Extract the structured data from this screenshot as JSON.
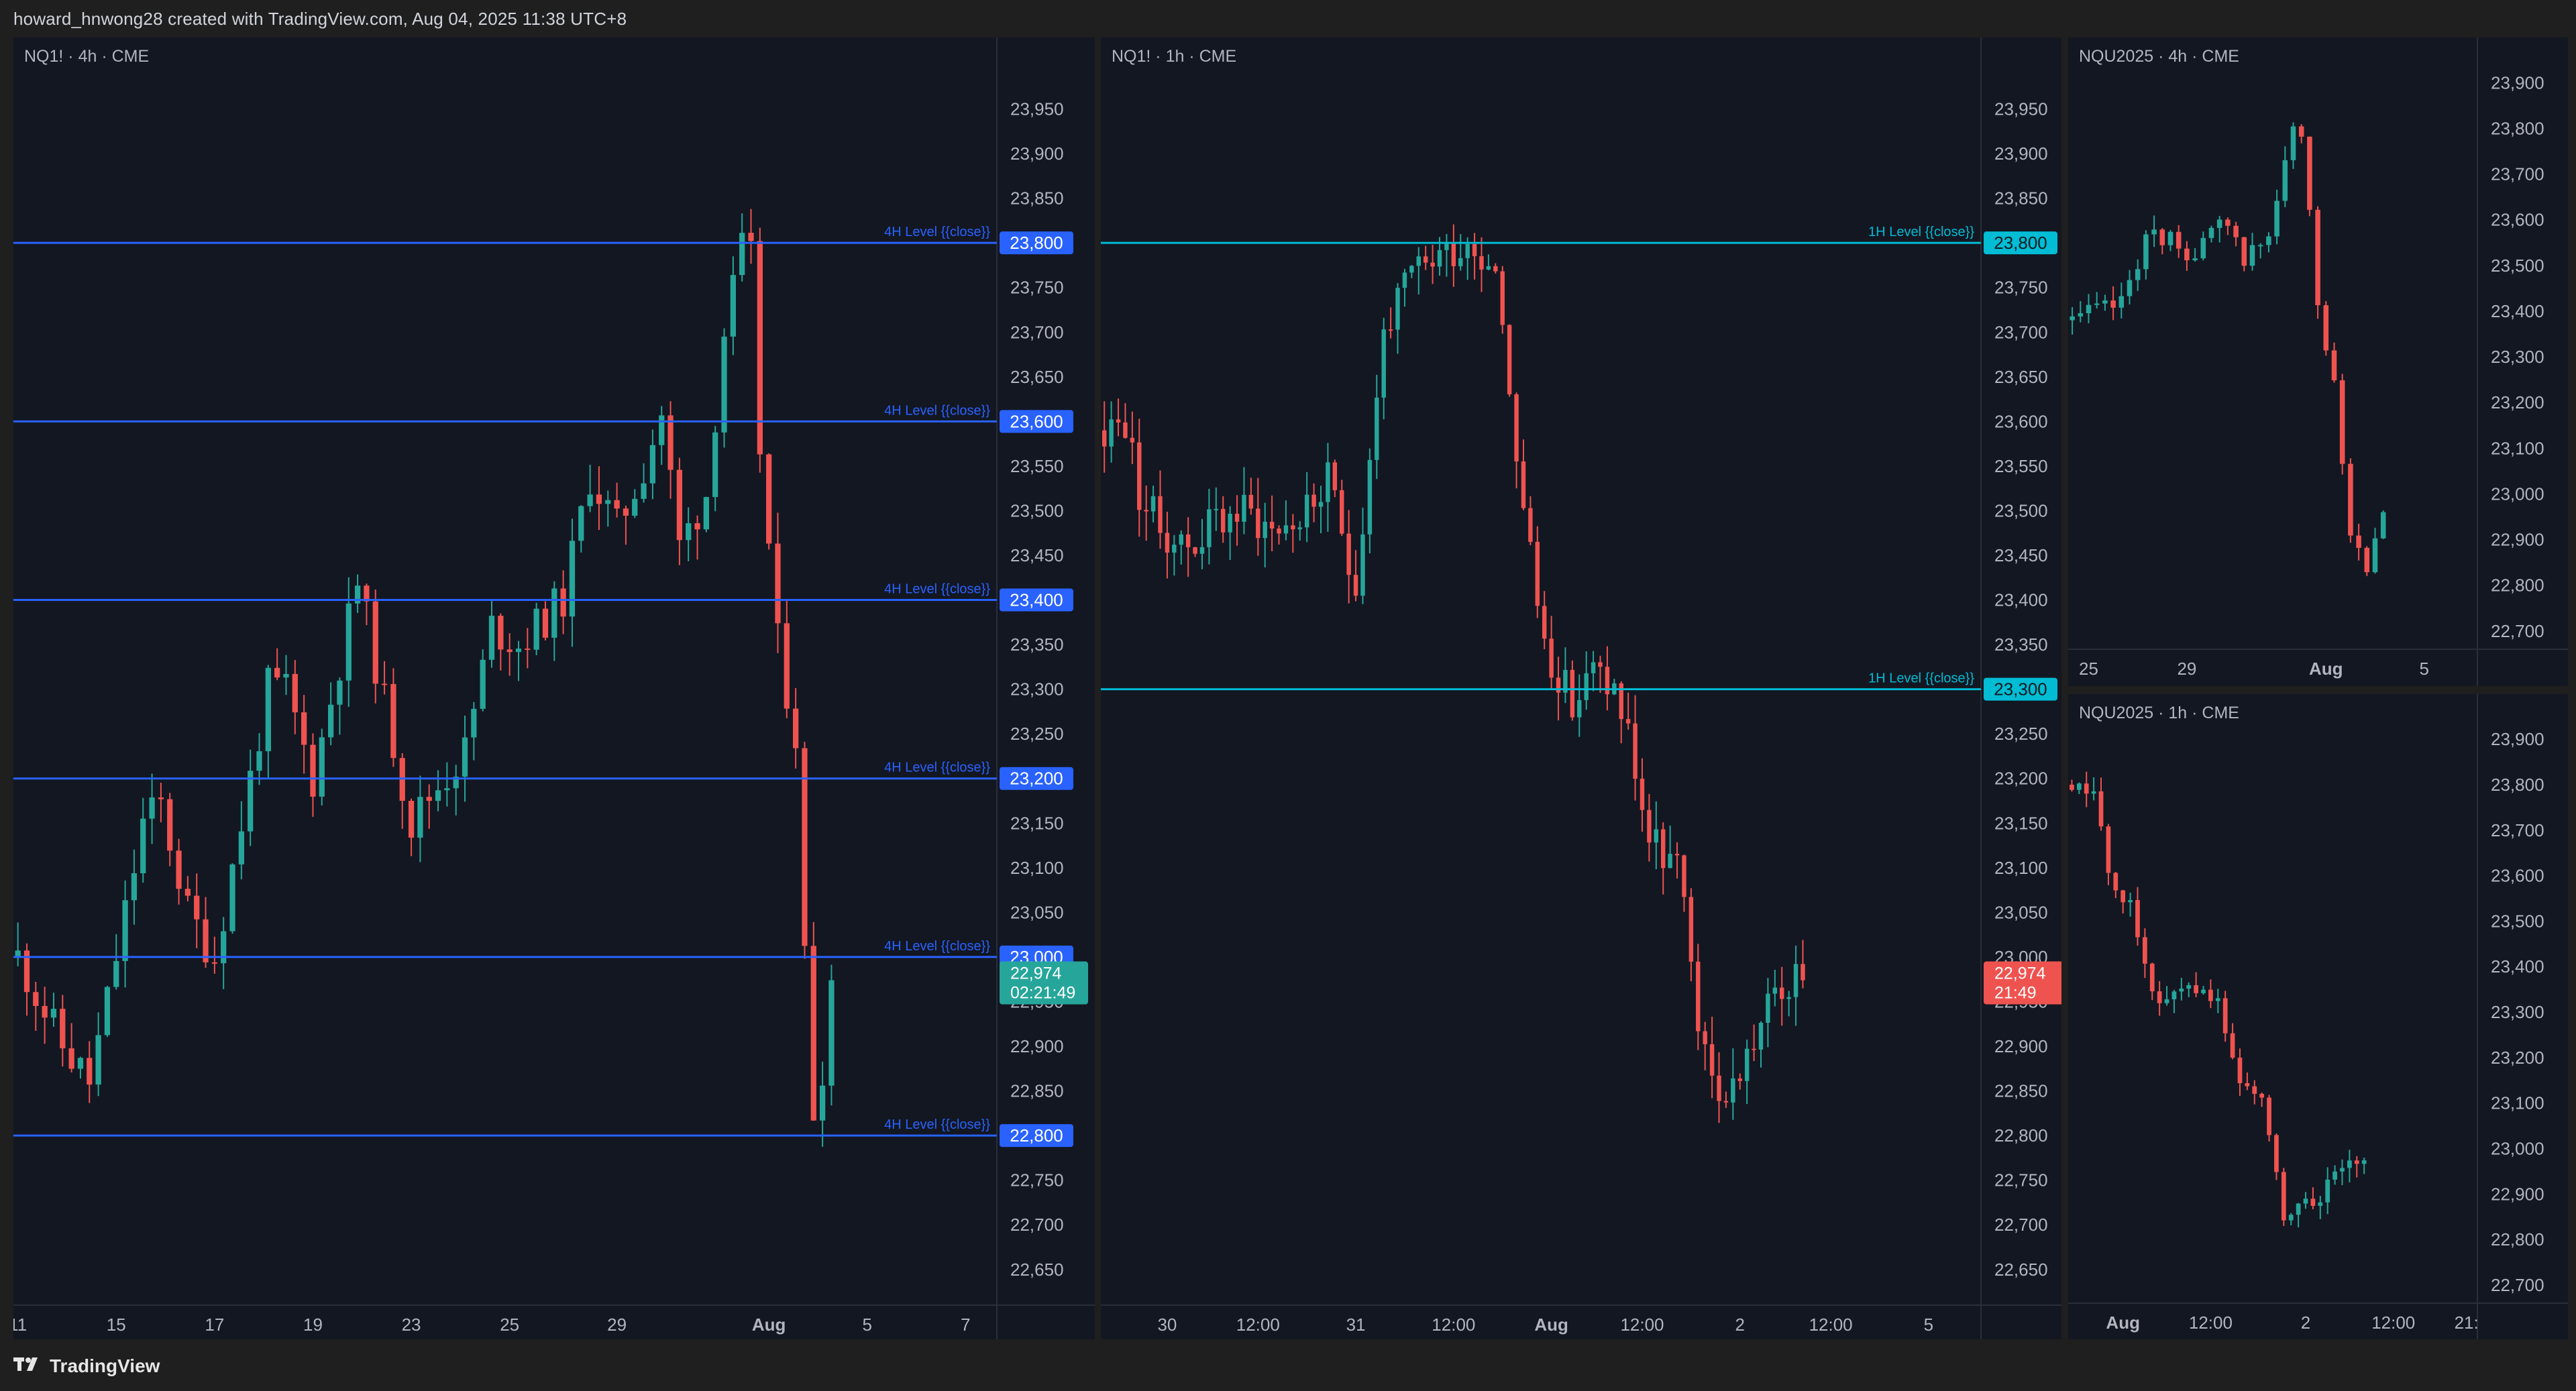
{
  "header": {
    "attribution": "howard_hnwong28 created with TradingView.com, Aug 04, 2025 11:38 UTC+8"
  },
  "footer": {
    "brand": "TradingView",
    "logo_icon": "tradingview-logo-icon"
  },
  "colors": {
    "background": "#131722",
    "up": "#26a69a",
    "down": "#ef5350",
    "level_4h": "#2962ff",
    "level_1h": "#00bcd4"
  },
  "chart_data": [
    {
      "type": "candlestick",
      "title": "NQ1! · 4h · CME",
      "ylim": [
        22610,
        24000
      ],
      "y_ticks": [
        "23,950",
        "23,900",
        "23,850",
        "23,800",
        "23,750",
        "23,700",
        "23,650",
        "23,600",
        "23,550",
        "23,500",
        "23,450",
        "23,400",
        "23,350",
        "23,300",
        "23,250",
        "23,200",
        "23,150",
        "23,100",
        "23,050",
        "23,000",
        "22,950",
        "22,900",
        "22,850",
        "22,800",
        "22,750",
        "22,700",
        "22,650"
      ],
      "y_tick_values": [
        23950,
        23900,
        23850,
        23800,
        23750,
        23700,
        23650,
        23600,
        23550,
        23500,
        23450,
        23400,
        23350,
        23300,
        23250,
        23200,
        23150,
        23100,
        23050,
        23000,
        22950,
        22900,
        22850,
        22800,
        22750,
        22700,
        22650
      ],
      "x_ticks": [
        "11",
        "15",
        "17",
        "19",
        "23",
        "25",
        "29",
        "Aug",
        "5",
        "7"
      ],
      "x_tick_slots": [
        0,
        11,
        22,
        33,
        44,
        55,
        67,
        84,
        95,
        106
      ],
      "total_slots": 110,
      "levels": [
        {
          "value": 23800,
          "label": "4H Level {{close}}",
          "tag": "23,800"
        },
        {
          "value": 23600,
          "label": "4H Level {{close}}",
          "tag": "23,600"
        },
        {
          "value": 23400,
          "label": "4H Level {{close}}",
          "tag": "23,400"
        },
        {
          "value": 23200,
          "label": "4H Level {{close}}",
          "tag": "23,200"
        },
        {
          "value": 23000,
          "label": "4H Level {{close}}",
          "tag": "23,000"
        },
        {
          "value": 22800,
          "label": "4H Level {{close}}",
          "tag": "22,800"
        }
      ],
      "last_price": {
        "value": 22974,
        "label": "22,974",
        "countdown": "02:21:49",
        "direction": "up"
      },
      "anchors": [
        [
          0,
          23000
        ],
        [
          5,
          22900
        ],
        [
          8,
          22860
        ],
        [
          10,
          22950
        ],
        [
          14,
          23150
        ],
        [
          16,
          23170
        ],
        [
          19,
          23050
        ],
        [
          22,
          23000
        ],
        [
          25,
          23150
        ],
        [
          28,
          23300
        ],
        [
          30,
          23300
        ],
        [
          33,
          23200
        ],
        [
          38,
          23420
        ],
        [
          40,
          23330
        ],
        [
          44,
          23150
        ],
        [
          46,
          23180
        ],
        [
          50,
          23230
        ],
        [
          53,
          23370
        ],
        [
          56,
          23350
        ],
        [
          61,
          23400
        ],
        [
          64,
          23540
        ],
        [
          67,
          23480
        ],
        [
          70,
          23550
        ],
        [
          72,
          23610
        ],
        [
          74,
          23460
        ],
        [
          77,
          23520
        ],
        [
          79,
          23700
        ],
        [
          81,
          23790
        ],
        [
          82,
          23780
        ],
        [
          83,
          23570
        ],
        [
          85,
          23350
        ],
        [
          87,
          23250
        ],
        [
          88,
          23000
        ],
        [
          89,
          22830
        ],
        [
          90,
          22880
        ],
        [
          91,
          22974
        ]
      ],
      "candle_count": 92
    },
    {
      "type": "candlestick",
      "title": "NQ1! · 1h · CME",
      "ylim": [
        22610,
        24000
      ],
      "y_ticks": [
        "23,950",
        "23,900",
        "23,850",
        "23,800",
        "23,750",
        "23,700",
        "23,650",
        "23,600",
        "23,550",
        "23,500",
        "23,450",
        "23,400",
        "23,350",
        "23,300",
        "23,250",
        "23,200",
        "23,150",
        "23,100",
        "23,050",
        "23,000",
        "22,950",
        "22,900",
        "22,850",
        "22,800",
        "22,750",
        "22,700",
        "22,650"
      ],
      "y_tick_values": [
        23950,
        23900,
        23850,
        23800,
        23750,
        23700,
        23650,
        23600,
        23550,
        23500,
        23450,
        23400,
        23350,
        23300,
        23250,
        23200,
        23150,
        23100,
        23050,
        23000,
        22950,
        22900,
        22850,
        22800,
        22750,
        22700,
        22650
      ],
      "x_ticks": [
        "30",
        "12:00",
        "31",
        "12:00",
        "Aug",
        "12:00",
        "2",
        "12:00",
        "5"
      ],
      "x_tick_slots": [
        9,
        22,
        36,
        50,
        64,
        77,
        91,
        104,
        118
      ],
      "total_slots": 126,
      "levels": [
        {
          "value": 23800,
          "label": "1H Level {{close}}",
          "tag": "23,800"
        },
        {
          "value": 23300,
          "label": "1H Level {{close}}",
          "tag": "23,300"
        }
      ],
      "last_price": {
        "value": 22974,
        "label": "22,974",
        "countdown": "21:49",
        "direction": "down"
      },
      "anchors": [
        [
          0,
          23590
        ],
        [
          3,
          23600
        ],
        [
          5,
          23520
        ],
        [
          8,
          23480
        ],
        [
          12,
          23460
        ],
        [
          16,
          23490
        ],
        [
          20,
          23500
        ],
        [
          24,
          23480
        ],
        [
          28,
          23490
        ],
        [
          32,
          23530
        ],
        [
          36,
          23420
        ],
        [
          40,
          23700
        ],
        [
          44,
          23760
        ],
        [
          48,
          23790
        ],
        [
          52,
          23800
        ],
        [
          56,
          23780
        ],
        [
          60,
          23500
        ],
        [
          63,
          23350
        ],
        [
          65,
          23320
        ],
        [
          67,
          23280
        ],
        [
          70,
          23320
        ],
        [
          73,
          23300
        ],
        [
          75,
          23250
        ],
        [
          78,
          23130
        ],
        [
          82,
          23100
        ],
        [
          86,
          22880
        ],
        [
          89,
          22840
        ],
        [
          92,
          22890
        ],
        [
          96,
          22960
        ],
        [
          100,
          22974
        ]
      ],
      "candle_count": 101
    },
    {
      "type": "candlestick",
      "title": "NQU2025 · 4h · CME",
      "ylim": [
        22660,
        23940
      ],
      "y_ticks": [
        "23,900",
        "23,800",
        "23,700",
        "23,600",
        "23,500",
        "23,400",
        "23,300",
        "23,200",
        "23,100",
        "23,000",
        "22,900",
        "22,800",
        "22,700"
      ],
      "y_tick_values": [
        23900,
        23800,
        23700,
        23600,
        23500,
        23400,
        23300,
        23200,
        23100,
        23000,
        22900,
        22800,
        22700
      ],
      "x_ticks": [
        "25",
        "29",
        "Aug",
        "5"
      ],
      "x_tick_slots": [
        2,
        14,
        31,
        43
      ],
      "total_slots": 50,
      "levels": [],
      "anchors": [
        [
          0,
          23380
        ],
        [
          3,
          23400
        ],
        [
          6,
          23420
        ],
        [
          9,
          23560
        ],
        [
          12,
          23560
        ],
        [
          15,
          23520
        ],
        [
          18,
          23590
        ],
        [
          21,
          23520
        ],
        [
          24,
          23560
        ],
        [
          27,
          23800
        ],
        [
          28,
          23780
        ],
        [
          30,
          23420
        ],
        [
          32,
          23250
        ],
        [
          34,
          22920
        ],
        [
          36,
          22850
        ],
        [
          38,
          22960
        ]
      ],
      "candle_count": 39
    },
    {
      "type": "candlestick",
      "title": "NQU2025 · 1h · CME",
      "ylim": [
        22660,
        23940
      ],
      "y_ticks": [
        "23,900",
        "23,800",
        "23,700",
        "23,600",
        "23,500",
        "23,400",
        "23,300",
        "23,200",
        "23,100",
        "23,000",
        "22,900",
        "22,800",
        "22,700"
      ],
      "y_tick_values": [
        23900,
        23800,
        23700,
        23600,
        23500,
        23400,
        23300,
        23200,
        23100,
        23000,
        22900,
        22800,
        22700
      ],
      "x_ticks": [
        "Aug",
        "12:00",
        "2",
        "12:00",
        "21:"
      ],
      "x_tick_slots": [
        7,
        19,
        32,
        44,
        54
      ],
      "total_slots": 56,
      "levels": [],
      "anchors": [
        [
          0,
          23800
        ],
        [
          3,
          23780
        ],
        [
          5,
          23600
        ],
        [
          8,
          23540
        ],
        [
          11,
          23340
        ],
        [
          14,
          23330
        ],
        [
          17,
          23340
        ],
        [
          20,
          23310
        ],
        [
          23,
          23150
        ],
        [
          26,
          23090
        ],
        [
          29,
          22860
        ],
        [
          32,
          22870
        ],
        [
          35,
          22920
        ],
        [
          38,
          22960
        ],
        [
          40,
          22974
        ]
      ],
      "candle_count": 41
    }
  ]
}
